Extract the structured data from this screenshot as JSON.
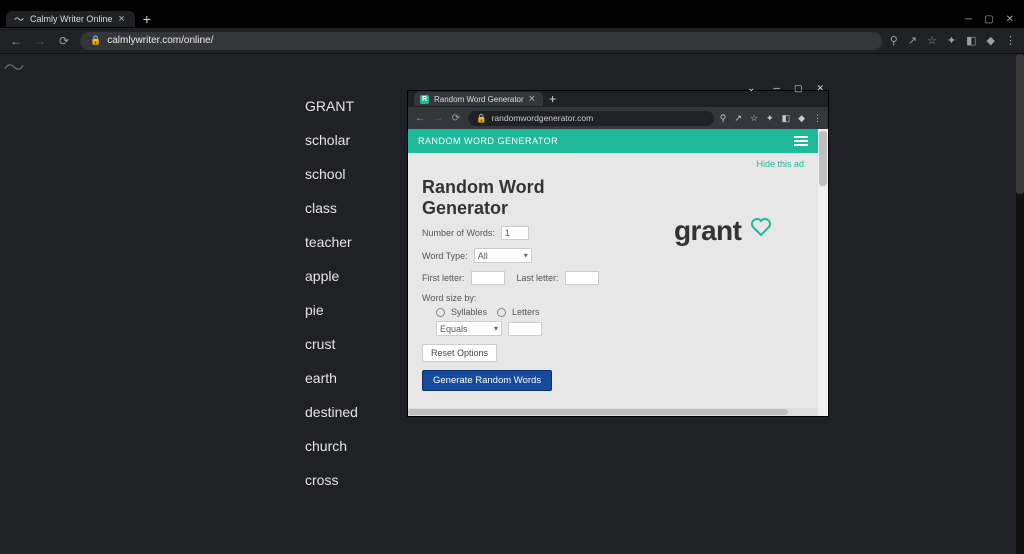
{
  "outer": {
    "tab_title": "Calmly Writer Online",
    "url": "calmlywriter.com/online/",
    "url_secondary": "/online/"
  },
  "words": [
    "GRANT",
    "scholar",
    "school",
    "class",
    "teacher",
    "apple",
    "pie",
    "crust",
    "earth",
    "destined",
    "church",
    "cross"
  ],
  "popup": {
    "tab_title": "Random Word Generator",
    "url": "randomwordgenerator.com",
    "brand": "RANDOM WORD GENERATOR",
    "hide_ad": "Hide this ad",
    "h1_line1": "Random Word",
    "h1_line2": "Generator",
    "label_num": "Number of Words:",
    "val_num": "1",
    "label_type": "Word Type:",
    "val_type": "All",
    "label_first": "First letter:",
    "label_last": "Last letter:",
    "label_size": "Word size by:",
    "opt_syll": "Syllables",
    "opt_lett": "Letters",
    "val_sizecmp": "Equals",
    "btn_reset": "Reset Options",
    "btn_gen": "Generate Random Words",
    "result": "grant"
  }
}
